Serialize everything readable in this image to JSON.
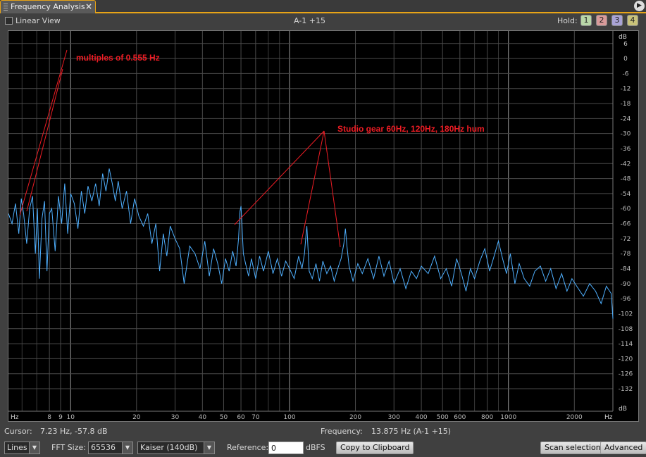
{
  "panel": {
    "title": "Frequency Analysis",
    "close_glyph": "×",
    "menu_glyph": "▶"
  },
  "view": {
    "linear_label": "Linear View",
    "channel_label": "A-1 +15"
  },
  "hold": {
    "label": "Hold:",
    "buttons": [
      {
        "label": "1",
        "color": "#b9d7a8"
      },
      {
        "label": "2",
        "color": "#d99a9a"
      },
      {
        "label": "3",
        "color": "#a9a3d6"
      },
      {
        "label": "4",
        "color": "#c9c37a"
      }
    ]
  },
  "status": {
    "cursor_label": "Cursor:",
    "cursor_value": "7.23 Hz,  -57.8 dB",
    "freq_label": "Frequency:",
    "freq_value": "13.875 Hz (A-1 +15)"
  },
  "controls": {
    "display_mode": "Lines",
    "fft_label": "FFT Size:",
    "fft_value": "65536",
    "window_value": "Kaiser (140dB)",
    "reference_label": "Reference:",
    "reference_value": "0",
    "reference_unit": "dBFS",
    "copy_button": "Copy to Clipboard",
    "scan_button": "Scan selection",
    "advanced_button": "Advanced"
  },
  "chart_data": {
    "type": "line",
    "x_scale": "log",
    "xlim": [
      5.2,
      3000
    ],
    "ylim": [
      -141,
      11
    ],
    "x_unit_label": "Hz",
    "y_unit_label": "dB",
    "x_ticks": [
      {
        "v": 8,
        "label": "8"
      },
      {
        "v": 9,
        "label": "9"
      },
      {
        "v": 10,
        "label": "10",
        "bright": true
      },
      {
        "v": 20,
        "label": "20"
      },
      {
        "v": 30,
        "label": "30"
      },
      {
        "v": 40,
        "label": "40"
      },
      {
        "v": 50,
        "label": "50"
      },
      {
        "v": 60,
        "label": "60"
      },
      {
        "v": 70,
        "label": "70"
      },
      {
        "v": 100,
        "label": "100",
        "bright": true
      },
      {
        "v": 200,
        "label": "200"
      },
      {
        "v": 300,
        "label": "300"
      },
      {
        "v": 400,
        "label": "400"
      },
      {
        "v": 500,
        "label": "500"
      },
      {
        "v": 600,
        "label": "600"
      },
      {
        "v": 800,
        "label": "800"
      },
      {
        "v": 1000,
        "label": "1000",
        "bright": true
      },
      {
        "v": 2000,
        "label": "2000"
      }
    ],
    "x_minor_ticks": [
      6,
      7,
      80,
      90,
      700,
      900,
      3000
    ],
    "y_ticks": [
      6,
      0,
      -6,
      -12,
      -18,
      -24,
      -30,
      -36,
      -42,
      -48,
      -54,
      -60,
      -66,
      -72,
      -78,
      -84,
      -90,
      -96,
      -102,
      -108,
      -114,
      -120,
      -126,
      -132
    ],
    "grid": true,
    "series": [
      {
        "color": "#4fb0ff",
        "points": [
          [
            5.2,
            -62
          ],
          [
            5.4,
            -66
          ],
          [
            5.6,
            -58
          ],
          [
            5.8,
            -70
          ],
          [
            5.95,
            -56
          ],
          [
            6.1,
            -62
          ],
          [
            6.3,
            -74
          ],
          [
            6.5,
            -60
          ],
          [
            6.7,
            -55
          ],
          [
            6.9,
            -78
          ],
          [
            7.05,
            -60
          ],
          [
            7.2,
            -88
          ],
          [
            7.4,
            -64
          ],
          [
            7.6,
            -57
          ],
          [
            7.8,
            -85
          ],
          [
            8.0,
            -62
          ],
          [
            8.2,
            -60
          ],
          [
            8.5,
            -77
          ],
          [
            8.8,
            -55
          ],
          [
            9.1,
            -66
          ],
          [
            9.4,
            -50
          ],
          [
            9.7,
            -70
          ],
          [
            10.0,
            -54
          ],
          [
            10.4,
            -58
          ],
          [
            10.8,
            -68
          ],
          [
            11.2,
            -53
          ],
          [
            11.6,
            -62
          ],
          [
            12.0,
            -51
          ],
          [
            12.5,
            -57
          ],
          [
            13.0,
            -50
          ],
          [
            13.5,
            -59
          ],
          [
            14.0,
            -46
          ],
          [
            14.5,
            -53
          ],
          [
            15.0,
            -44
          ],
          [
            15.5,
            -50
          ],
          [
            16.0,
            -57
          ],
          [
            16.5,
            -49
          ],
          [
            17.2,
            -60
          ],
          [
            18.0,
            -53
          ],
          [
            18.8,
            -66
          ],
          [
            19.6,
            -56
          ],
          [
            20.5,
            -63
          ],
          [
            21.5,
            -67
          ],
          [
            22.5,
            -62
          ],
          [
            23.5,
            -74
          ],
          [
            24.5,
            -66
          ],
          [
            25.5,
            -85
          ],
          [
            26.5,
            -70
          ],
          [
            27.5,
            -79
          ],
          [
            28.5,
            -67
          ],
          [
            30,
            -72
          ],
          [
            31.5,
            -76
          ],
          [
            33,
            -90
          ],
          [
            35,
            -75
          ],
          [
            37,
            -78
          ],
          [
            39,
            -84
          ],
          [
            41,
            -73
          ],
          [
            43,
            -87
          ],
          [
            45,
            -76
          ],
          [
            47,
            -82
          ],
          [
            49,
            -90
          ],
          [
            51,
            -80
          ],
          [
            53,
            -85
          ],
          [
            55,
            -77
          ],
          [
            57,
            -83
          ],
          [
            58.5,
            -72
          ],
          [
            59.4,
            -61
          ],
          [
            60.0,
            -59
          ],
          [
            60.6,
            -66
          ],
          [
            61.5,
            -78
          ],
          [
            63,
            -82
          ],
          [
            65,
            -87
          ],
          [
            67,
            -80
          ],
          [
            70,
            -88
          ],
          [
            73,
            -79
          ],
          [
            76,
            -85
          ],
          [
            80,
            -77
          ],
          [
            84,
            -86
          ],
          [
            88,
            -80
          ],
          [
            92,
            -87
          ],
          [
            96,
            -81
          ],
          [
            100,
            -84
          ],
          [
            105,
            -88
          ],
          [
            110,
            -79
          ],
          [
            114,
            -84
          ],
          [
            117,
            -78
          ],
          [
            119,
            -70
          ],
          [
            120,
            -67
          ],
          [
            121,
            -73
          ],
          [
            123,
            -85
          ],
          [
            127,
            -88
          ],
          [
            132,
            -82
          ],
          [
            137,
            -89
          ],
          [
            142,
            -81
          ],
          [
            148,
            -86
          ],
          [
            154,
            -83
          ],
          [
            160,
            -89
          ],
          [
            166,
            -84
          ],
          [
            172,
            -80
          ],
          [
            177,
            -74
          ],
          [
            180,
            -68
          ],
          [
            183,
            -75
          ],
          [
            187,
            -83
          ],
          [
            195,
            -89
          ],
          [
            205,
            -82
          ],
          [
            215,
            -86
          ],
          [
            228,
            -80
          ],
          [
            242,
            -88
          ],
          [
            256,
            -79
          ],
          [
            270,
            -87
          ],
          [
            285,
            -81
          ],
          [
            300,
            -90
          ],
          [
            320,
            -84
          ],
          [
            340,
            -92
          ],
          [
            360,
            -85
          ],
          [
            380,
            -88
          ],
          [
            400,
            -83
          ],
          [
            430,
            -86
          ],
          [
            460,
            -79
          ],
          [
            490,
            -88
          ],
          [
            520,
            -84
          ],
          [
            550,
            -91
          ],
          [
            580,
            -80
          ],
          [
            610,
            -86
          ],
          [
            640,
            -93
          ],
          [
            670,
            -84
          ],
          [
            700,
            -88
          ],
          [
            740,
            -81
          ],
          [
            780,
            -76
          ],
          [
            820,
            -85
          ],
          [
            860,
            -79
          ],
          [
            900,
            -73
          ],
          [
            940,
            -80
          ],
          [
            980,
            -86
          ],
          [
            1020,
            -78
          ],
          [
            1070,
            -90
          ],
          [
            1120,
            -82
          ],
          [
            1180,
            -88
          ],
          [
            1250,
            -91
          ],
          [
            1320,
            -85
          ],
          [
            1400,
            -83
          ],
          [
            1480,
            -89
          ],
          [
            1560,
            -84
          ],
          [
            1650,
            -92
          ],
          [
            1750,
            -86
          ],
          [
            1850,
            -93
          ],
          [
            1950,
            -88
          ],
          [
            2050,
            -91
          ],
          [
            2200,
            -95
          ],
          [
            2350,
            -90
          ],
          [
            2500,
            -93
          ],
          [
            2650,
            -98
          ],
          [
            2800,
            -91
          ],
          [
            2950,
            -94
          ],
          [
            3000,
            -104
          ]
        ]
      }
    ],
    "annotations": [
      {
        "text": "multiples of 0.555 Hz",
        "color": "#ee1c24"
      },
      {
        "text": "Studio gear 60Hz, 120Hz, 180Hz hum",
        "color": "#ee1c24"
      }
    ]
  }
}
